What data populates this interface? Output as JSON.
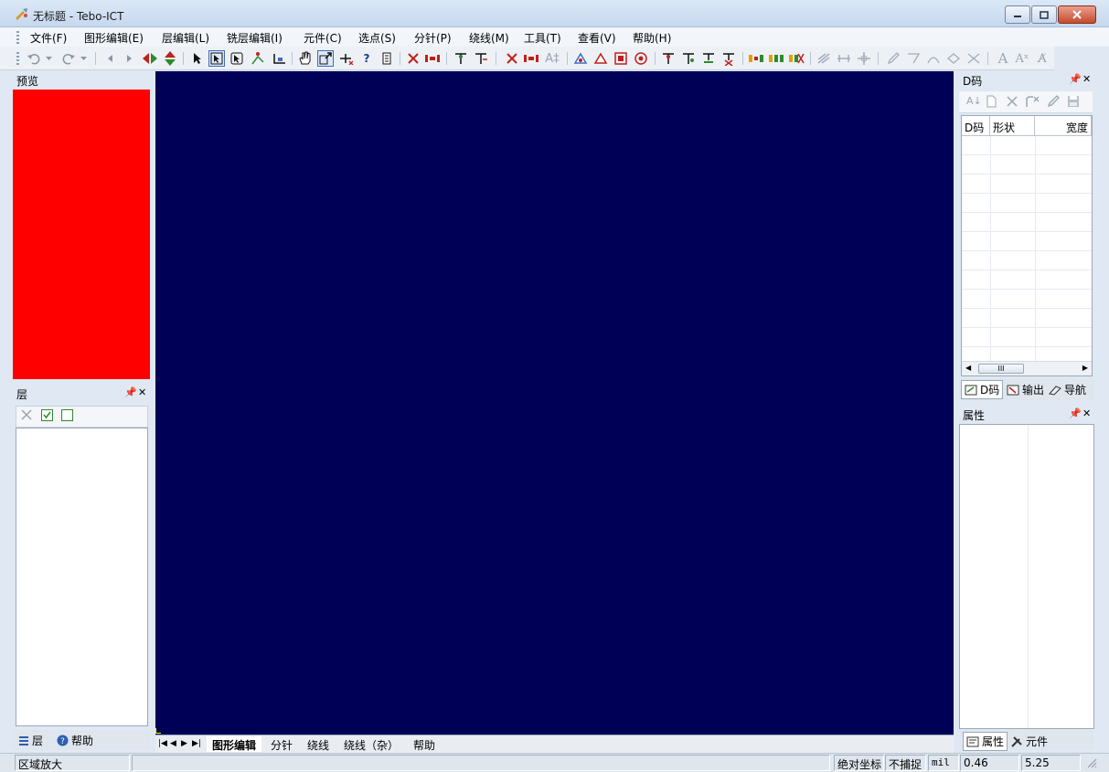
{
  "window": {
    "title": "无标题 - Tebo-ICT"
  },
  "menu": [
    "文件(F)",
    "图形编辑(E)",
    "层编辑(L)",
    "铣层编辑(I)",
    "元件(C)",
    "选点(S)",
    "分针(P)",
    "绕线(M)",
    "工具(T)",
    "查看(V)",
    "帮助(H)"
  ],
  "panels": {
    "preview": {
      "title": "预览",
      "color": "#ff0000"
    },
    "layer": {
      "title": "层"
    },
    "dcode": {
      "title": "D码",
      "columns": [
        "D码",
        "形状",
        "宽度"
      ],
      "scroll_label": "III"
    },
    "property": {
      "title": "属性"
    }
  },
  "left_tabs": {
    "layer": "层",
    "help": "帮助"
  },
  "right_top_tabs": {
    "dcode": "D码",
    "output": "输出",
    "nav": "导航"
  },
  "right_bottom_tabs": {
    "property": "属性",
    "component": "元件"
  },
  "sheet_tabs": [
    "图形编辑",
    "分针",
    "绕线",
    "绕线（杂）",
    "帮助"
  ],
  "canvas": {
    "background": "#000057"
  },
  "status": {
    "mode": "区域放大",
    "coord_mode": "绝对坐标",
    "snap": "不捕捉",
    "unit": "mil",
    "x": "0.46",
    "y": "5.25"
  }
}
